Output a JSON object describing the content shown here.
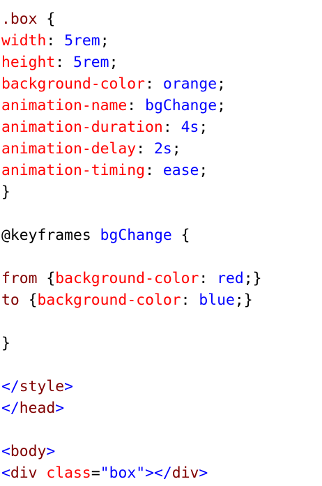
{
  "colors": {
    "selector": "#800000",
    "property": "#ff0000",
    "value": "#0000ff",
    "punctuation": "#000000",
    "background": "#ffffff"
  },
  "lines": [
    [
      {
        "t": "sel",
        "text": ".box"
      },
      {
        "t": "punc",
        "text": " {"
      }
    ],
    [
      {
        "t": "prop",
        "text": "width"
      },
      {
        "t": "punc",
        "text": ": "
      },
      {
        "t": "val",
        "text": "5rem"
      },
      {
        "t": "punc",
        "text": ";"
      }
    ],
    [
      {
        "t": "prop",
        "text": "height"
      },
      {
        "t": "punc",
        "text": ": "
      },
      {
        "t": "val",
        "text": "5rem"
      },
      {
        "t": "punc",
        "text": ";"
      }
    ],
    [
      {
        "t": "prop",
        "text": "background-color"
      },
      {
        "t": "punc",
        "text": ": "
      },
      {
        "t": "val",
        "text": "orange"
      },
      {
        "t": "punc",
        "text": ";"
      }
    ],
    [
      {
        "t": "prop",
        "text": "animation-name"
      },
      {
        "t": "punc",
        "text": ": "
      },
      {
        "t": "val",
        "text": "bgChange"
      },
      {
        "t": "punc",
        "text": ";"
      }
    ],
    [
      {
        "t": "prop",
        "text": "animation-duration"
      },
      {
        "t": "punc",
        "text": ": "
      },
      {
        "t": "val",
        "text": "4s"
      },
      {
        "t": "punc",
        "text": ";"
      }
    ],
    [
      {
        "t": "prop",
        "text": "animation-delay"
      },
      {
        "t": "punc",
        "text": ": "
      },
      {
        "t": "val",
        "text": "2s"
      },
      {
        "t": "punc",
        "text": ";"
      }
    ],
    [
      {
        "t": "prop",
        "text": "animation-timing"
      },
      {
        "t": "punc",
        "text": ": "
      },
      {
        "t": "val",
        "text": "ease"
      },
      {
        "t": "punc",
        "text": ";"
      }
    ],
    [
      {
        "t": "punc",
        "text": "}"
      }
    ],
    [],
    [
      {
        "t": "punc",
        "text": "@keyframes "
      },
      {
        "t": "val",
        "text": "bgChange"
      },
      {
        "t": "punc",
        "text": " {"
      }
    ],
    [],
    [
      {
        "t": "sel",
        "text": "from"
      },
      {
        "t": "punc",
        "text": " {"
      },
      {
        "t": "prop",
        "text": "background-color"
      },
      {
        "t": "punc",
        "text": ": "
      },
      {
        "t": "val",
        "text": "red"
      },
      {
        "t": "punc",
        "text": ";}"
      }
    ],
    [
      {
        "t": "sel",
        "text": "to"
      },
      {
        "t": "punc",
        "text": " {"
      },
      {
        "t": "prop",
        "text": "background-color"
      },
      {
        "t": "punc",
        "text": ": "
      },
      {
        "t": "val",
        "text": "blue"
      },
      {
        "t": "punc",
        "text": ";}"
      }
    ],
    [],
    [
      {
        "t": "punc",
        "text": "}"
      }
    ],
    [],
    [
      {
        "t": "br",
        "text": "</"
      },
      {
        "t": "tag",
        "text": "style"
      },
      {
        "t": "br",
        "text": ">"
      }
    ],
    [
      {
        "t": "br",
        "text": "</"
      },
      {
        "t": "tag",
        "text": "head"
      },
      {
        "t": "br",
        "text": ">"
      }
    ],
    [],
    [
      {
        "t": "br",
        "text": "<"
      },
      {
        "t": "tag",
        "text": "body"
      },
      {
        "t": "br",
        "text": ">"
      }
    ],
    [
      {
        "t": "br",
        "text": "<"
      },
      {
        "t": "tag",
        "text": "div"
      },
      {
        "t": "punc",
        "text": " "
      },
      {
        "t": "atr",
        "text": "class"
      },
      {
        "t": "punc",
        "text": "="
      },
      {
        "t": "val",
        "text": "\"box\""
      },
      {
        "t": "br",
        "text": "></"
      },
      {
        "t": "tag",
        "text": "div"
      },
      {
        "t": "br",
        "text": ">"
      }
    ]
  ]
}
